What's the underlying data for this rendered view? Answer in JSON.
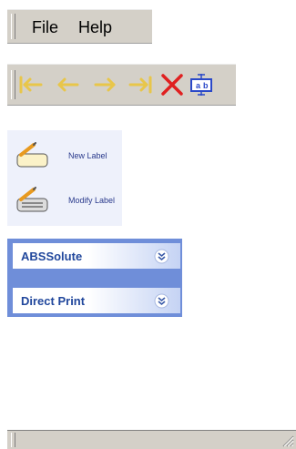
{
  "menubar": {
    "items": [
      "File",
      "Help"
    ]
  },
  "toolbar": {
    "buttons": [
      {
        "icon": "first-record-icon"
      },
      {
        "icon": "previous-record-icon"
      },
      {
        "icon": "next-record-icon"
      },
      {
        "icon": "last-record-icon"
      },
      {
        "icon": "delete-icon"
      },
      {
        "icon": "text-field-icon"
      }
    ],
    "colors": {
      "arrow": "#e8c64a",
      "delete": "#e02020",
      "text_field": "#2a48c8"
    }
  },
  "label_tasks": [
    {
      "label": "New Label",
      "icon": "new-label-icon"
    },
    {
      "label": "Modify Label",
      "icon": "modify-label-icon"
    }
  ],
  "explorer_bar": {
    "groups": [
      {
        "label": "ABSSolute",
        "icon": "chevron-double-down-icon"
      },
      {
        "label": "Direct Print",
        "icon": "chevron-double-down-icon"
      }
    ],
    "colors": {
      "background": "#6f8ed9",
      "header_text": "#21479c"
    }
  }
}
